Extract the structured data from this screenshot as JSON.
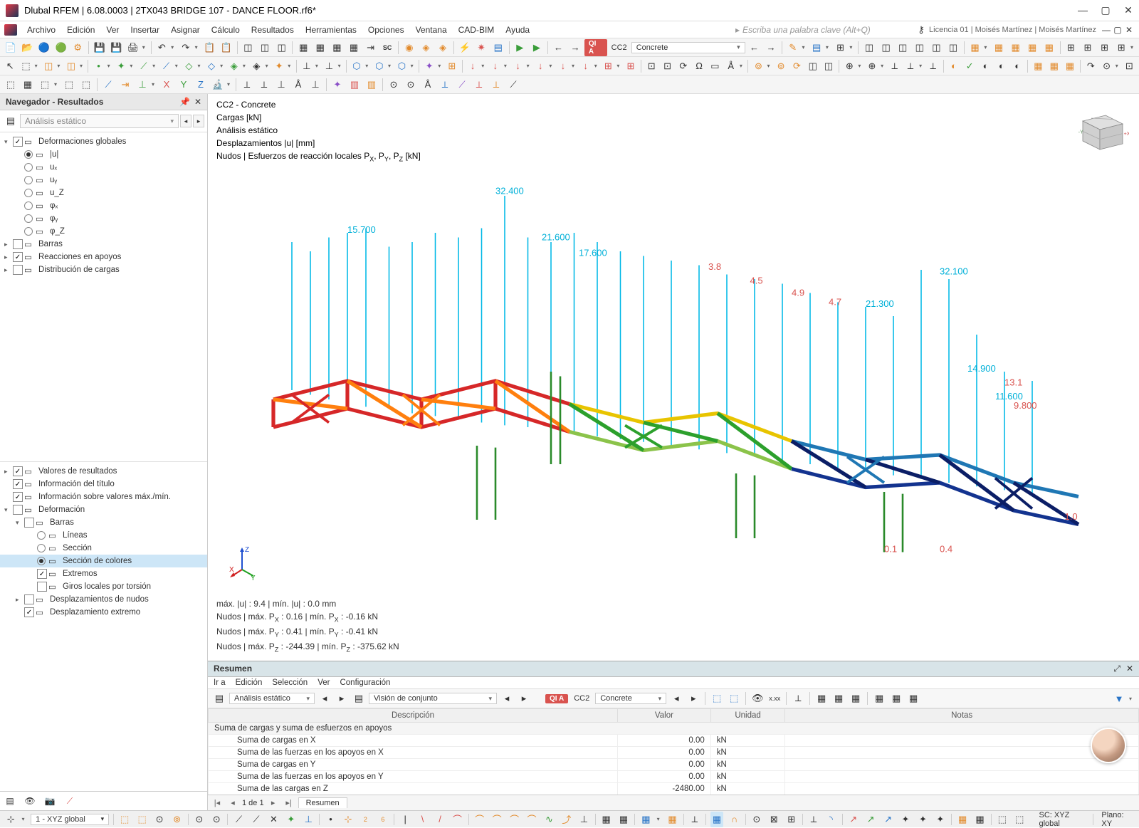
{
  "titlebar": {
    "title": "Dlubal RFEM | 6.08.0003 | 2TX043 BRIDGE 107 - DANCE FLOOR.rf6*"
  },
  "menubar": {
    "items": [
      "Archivo",
      "Edición",
      "Ver",
      "Insertar",
      "Asignar",
      "Cálculo",
      "Resultados",
      "Herramientas",
      "Opciones",
      "Ventana",
      "CAD-BIM",
      "Ayuda"
    ],
    "search_placeholder": "Escriba una palabra clave (Alt+Q)",
    "license": "Licencia 01 | Moisés Martínez | Moisés Martínez"
  },
  "toolbar1": {
    "badge": "QI A",
    "cc_label": "CC2",
    "combo_value": "Concrete"
  },
  "navigator": {
    "title": "Navegador - Resultados",
    "combo": "Análisis estático",
    "tree_top": [
      {
        "exp": "▾",
        "chk": true,
        "label": "Deformaciones globales"
      },
      {
        "ind": 1,
        "rad": true,
        "label": "|u|"
      },
      {
        "ind": 1,
        "rad": false,
        "label": "uₓ"
      },
      {
        "ind": 1,
        "rad": false,
        "label": "uᵧ"
      },
      {
        "ind": 1,
        "rad": false,
        "label": "u_Z"
      },
      {
        "ind": 1,
        "rad": false,
        "label": "φₓ"
      },
      {
        "ind": 1,
        "rad": false,
        "label": "φᵧ"
      },
      {
        "ind": 1,
        "rad": false,
        "label": "φ_Z"
      },
      {
        "exp": "▸",
        "chk": false,
        "label": "Barras"
      },
      {
        "exp": "▸",
        "chk": true,
        "label": "Reacciones en apoyos"
      },
      {
        "exp": "▸",
        "chk": false,
        "label": "Distribución de cargas"
      }
    ],
    "tree_bottom": [
      {
        "exp": "▸",
        "chk": true,
        "label": "Valores de resultados"
      },
      {
        "chk": true,
        "label": "Información del título"
      },
      {
        "chk": true,
        "label": "Información sobre valores máx./mín."
      },
      {
        "exp": "▾",
        "chk": false,
        "label": "Deformación"
      },
      {
        "ind": 1,
        "exp": "▾",
        "chk": false,
        "label": "Barras"
      },
      {
        "ind": 2,
        "rad": false,
        "label": "Líneas"
      },
      {
        "ind": 2,
        "rad": false,
        "label": "Sección"
      },
      {
        "ind": 2,
        "rad": true,
        "sel": true,
        "label": "Sección de colores"
      },
      {
        "ind": 2,
        "chk": true,
        "label": "Extremos"
      },
      {
        "ind": 2,
        "chk": false,
        "label": "Giros locales por torsión"
      },
      {
        "ind": 1,
        "exp": "▸",
        "chk": false,
        "label": "Desplazamientos de nudos"
      },
      {
        "ind": 1,
        "chk": true,
        "label": "Desplazamiento extremo"
      }
    ]
  },
  "viewport": {
    "info": [
      "CC2 - Concrete",
      "Cargas [kN]",
      "Análisis estático",
      "Desplazamientos |u| [mm]",
      "Nudos | Esfuerzos de reacción locales Pₓ, Pᵧ, P_Z [kN]"
    ],
    "stats": [
      "máx. |u| : 9.4 | mín. |u| : 0.0 mm",
      "Nudos | máx. Pₓ : 0.16 | mín. Pₓ : -0.16 kN",
      "Nudos | máx. Pᵧ : 0.41 | mín. Pᵧ : -0.41 kN",
      "Nudos | máx. P_Z : -244.39 | mín. P_Z : -375.62 kN"
    ],
    "some_labels": [
      "32.400",
      "15.700",
      "21.600",
      "17.600",
      "32.100",
      "21.300",
      "14.900",
      "11.600",
      "3.8",
      "4.5",
      "4.9",
      "4.7",
      "1.0",
      "0.4",
      "0.1",
      "13.1",
      "9.800"
    ]
  },
  "summary": {
    "title": "Resumen",
    "menu": [
      "Ir a",
      "Edición",
      "Selección",
      "Ver",
      "Configuración"
    ],
    "combo1": "Análisis estático",
    "combo2": "Visión de conjunto",
    "badge": "QI A",
    "cc": "CC2",
    "cc_name": "Concrete",
    "headers": [
      "Descripción",
      "Valor",
      "Unidad",
      "Notas"
    ],
    "group": "Suma de cargas y suma de esfuerzos en apoyos",
    "rows": [
      {
        "desc": "Suma de cargas en X",
        "val": "0.00",
        "unit": "kN"
      },
      {
        "desc": "Suma de las fuerzas en los apoyos en X",
        "val": "0.00",
        "unit": "kN"
      },
      {
        "desc": "Suma de cargas en Y",
        "val": "0.00",
        "unit": "kN"
      },
      {
        "desc": "Suma de las fuerzas en los apoyos en Y",
        "val": "0.00",
        "unit": "kN"
      },
      {
        "desc": "Suma de las cargas en Z",
        "val": "-2480.00",
        "unit": "kN"
      }
    ],
    "page": "1 de 1",
    "tab": "Resumen"
  },
  "statusbar": {
    "coord_combo": "1 - XYZ global",
    "sc": "SC: XYZ global",
    "plano": "Plano: XY"
  }
}
